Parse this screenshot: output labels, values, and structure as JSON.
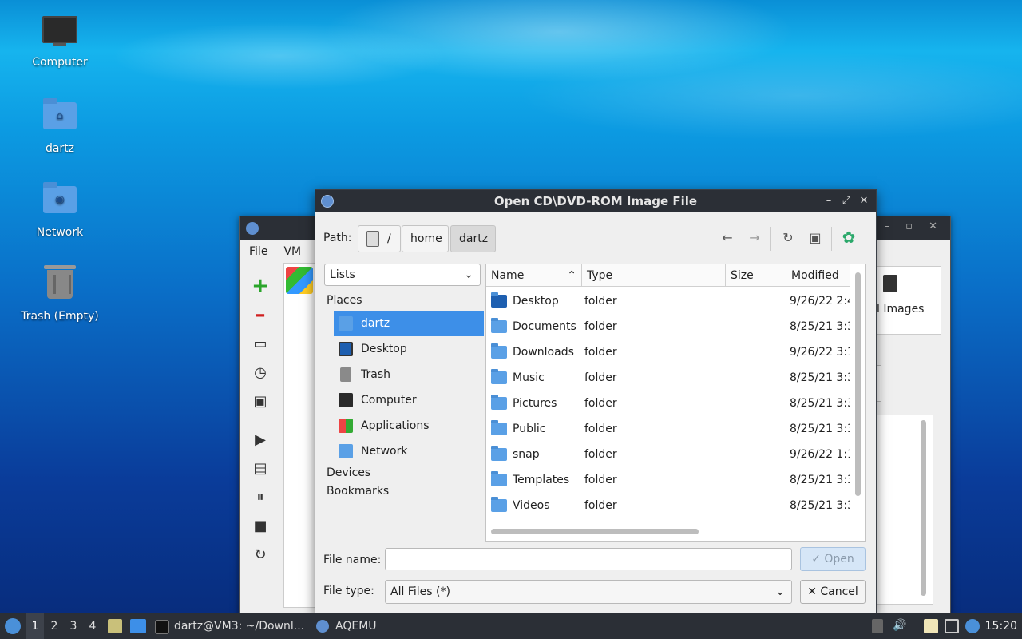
{
  "desktop": {
    "icons": [
      {
        "label": "Computer"
      },
      {
        "label": "dartz"
      },
      {
        "label": "Network"
      },
      {
        "label": "Trash (Empty)"
      }
    ]
  },
  "back_window": {
    "menu": [
      "File",
      "VM"
    ],
    "panel_label": "l Images"
  },
  "dialog": {
    "title": "Open CD\\DVD-ROM Image File",
    "path_label": "Path:",
    "crumbs": [
      "/",
      "home",
      "dartz"
    ],
    "lists_select": "Lists",
    "sections": {
      "places": "Places",
      "devices": "Devices",
      "bookmarks": "Bookmarks"
    },
    "places": [
      {
        "label": "dartz",
        "icon": "home-folder-icon",
        "selected": true
      },
      {
        "label": "Desktop",
        "icon": "desktop-icon"
      },
      {
        "label": "Trash",
        "icon": "trash-icon"
      },
      {
        "label": "Computer",
        "icon": "computer-icon"
      },
      {
        "label": "Applications",
        "icon": "applications-icon"
      },
      {
        "label": "Network",
        "icon": "network-icon"
      }
    ],
    "columns": {
      "name": "Name",
      "type": "Type",
      "size": "Size",
      "modified": "Modified"
    },
    "files": [
      {
        "name": "Desktop",
        "type": "folder",
        "modified": "9/26/22 2:4"
      },
      {
        "name": "Documents",
        "type": "folder",
        "modified": "8/25/21 3:3"
      },
      {
        "name": "Downloads",
        "type": "folder",
        "modified": "9/26/22 3:1"
      },
      {
        "name": "Music",
        "type": "folder",
        "modified": "8/25/21 3:3"
      },
      {
        "name": "Pictures",
        "type": "folder",
        "modified": "8/25/21 3:3"
      },
      {
        "name": "Public",
        "type": "folder",
        "modified": "8/25/21 3:3"
      },
      {
        "name": "snap",
        "type": "folder",
        "modified": "9/26/22 1:1"
      },
      {
        "name": "Templates",
        "type": "folder",
        "modified": "8/25/21 3:3"
      },
      {
        "name": "Videos",
        "type": "folder",
        "modified": "8/25/21 3:3"
      }
    ],
    "file_name_label": "File name:",
    "file_name_value": "",
    "file_type_label": "File type:",
    "file_type_value": "All Files (*)",
    "open_label": "Open",
    "cancel_label": "Cancel"
  },
  "taskbar": {
    "workspaces": [
      "1",
      "2",
      "3",
      "4"
    ],
    "tasks": [
      {
        "label": "dartz@VM3: ~/Downl..."
      },
      {
        "label": "AQEMU"
      }
    ],
    "clock": "15:20"
  },
  "colors": {
    "selection": "#3d8fe8",
    "titlebar": "#2b2f36",
    "folder": "#5aa0e6"
  }
}
